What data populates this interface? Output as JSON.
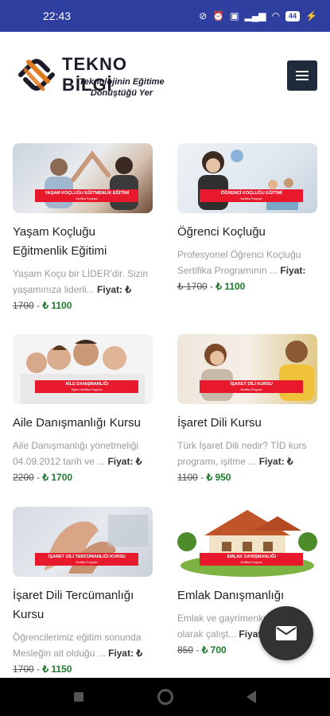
{
  "status": {
    "time": "22:43",
    "battery": "44"
  },
  "header": {
    "logo_title": "TEKNO BİLGİ",
    "logo_subtitle": "Teknolojinin Eğitime Dönüştüğü Yer"
  },
  "courses": [
    {
      "title": "Yaşam Koçluğu Eğitmenlik Eğitimi",
      "desc": "Yaşam Koçu bir LİDER'dir. Sizin yaşamınıza liderli...",
      "fiyat_label": "Fiyat: ₺",
      "old_price": "1700",
      "new_price": "₺ 1100",
      "banner": "YAŞAM KOÇLUĞU EĞİTMENLİK EĞİTİMİ",
      "banner_sub": "Sertifika Programı"
    },
    {
      "title": "Öğrenci Koçluğu",
      "desc": "Profesyonel Öğrenci Koçluğu Sertifika Programının ...",
      "fiyat_label": "Fiyat:",
      "old_price": "₺ 1700",
      "new_price": "₺ 1100",
      "banner": "ÖĞRENCİ KOÇLUĞU EĞİTİMİ",
      "banner_sub": "Sertifika Programı"
    },
    {
      "title": "Aile Danışmanlığı Kursu",
      "desc": "Aile Danışmanlığı yönetmeliği 04.09.2012 tarih ve ...",
      "fiyat_label": "Fiyat: ₺",
      "old_price": "2200",
      "new_price": "₺ 1700",
      "banner": "AİLE DANIŞMANLIĞI",
      "banner_sub": "Eğitim Sertifika Programı"
    },
    {
      "title": "İşaret Dili Kursu",
      "desc": "Türk İşaret Dili nedir? TİD kurs programı, işitme ...",
      "fiyat_label": "Fiyat: ₺",
      "old_price": "1100",
      "new_price": "₺ 950",
      "banner": "İŞARET DİLİ KURSU",
      "banner_sub": "Sertifika Programı"
    },
    {
      "title": "İşaret Dili Tercümanlığı Kursu",
      "desc": "Öğrencilerimiz eğitim sonunda Mesleğin ait olduğu ...",
      "fiyat_label": "Fiyat: ₺",
      "old_price": "1700",
      "new_price": "₺ 1150",
      "banner": "İŞARET DİLİ TERCÜMANLIĞI KURSU",
      "banner_sub": "Sertifika Programı"
    },
    {
      "title": "Emlak Danışmanlığı",
      "desc": "Emlak ve gayrimenkul ... resmi olarak çalışt...",
      "fiyat_label": "Fiyat: ₺",
      "old_price": "850",
      "new_price": "₺ 700",
      "banner": "EMLAK DANIŞMANLIĞI",
      "banner_sub": "Sertifika Programı"
    }
  ],
  "colors": {
    "status_bar": "#2f3fa0",
    "banner_red": "#e8192c",
    "price_green": "#1f7a2e"
  },
  "icons": {
    "menu": "hamburger-icon",
    "fab": "mail-icon"
  }
}
